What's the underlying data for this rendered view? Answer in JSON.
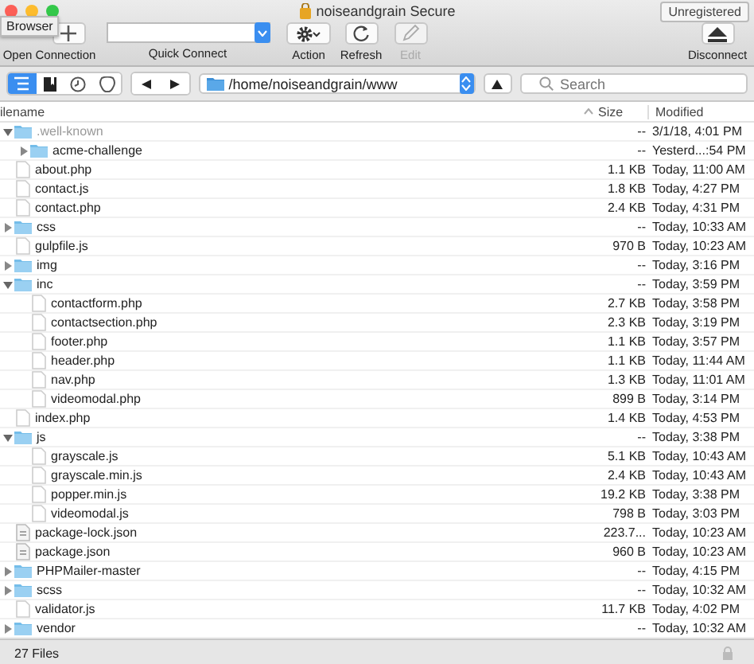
{
  "window": {
    "title": "noiseandgrain Secure",
    "badge": "Unregistered"
  },
  "tooltip": "Browser",
  "toolbar": [
    {
      "kind": "open",
      "label": "Open Connection",
      "disabled": false
    },
    {
      "kind": "combo",
      "label": "Quick Connect",
      "disabled": false
    },
    {
      "kind": "action",
      "label": "Action",
      "disabled": false
    },
    {
      "kind": "refresh",
      "label": "Refresh",
      "disabled": false
    },
    {
      "kind": "edit",
      "label": "Edit",
      "disabled": true
    },
    {
      "kind": "disconnect",
      "label": "Disconnect",
      "disabled": false
    }
  ],
  "views": [
    {
      "kind": "browser",
      "selected": true
    },
    {
      "kind": "bookmarks",
      "selected": false
    },
    {
      "kind": "history",
      "selected": false
    },
    {
      "kind": "bonjour",
      "selected": false
    }
  ],
  "path": "/home/noiseandgrain/www",
  "search": {
    "placeholder": "Search"
  },
  "columns": [
    "ilename",
    "Size",
    "Modified"
  ],
  "rows": [
    {
      "kind": "folder",
      "name": ".well-known",
      "size": "--",
      "modified": "3/1/18, 4:01 PM",
      "hidden": true,
      "expanded": true,
      "children": [
        {
          "kind": "folder",
          "name": "acme-challenge",
          "size": "--",
          "modified": "Yesterd...:54 PM",
          "hidden": false,
          "expanded": false
        }
      ]
    },
    {
      "kind": "file",
      "name": "about.php",
      "size": "1.1 KB",
      "modified": "Today, 11:00 AM",
      "hidden": false
    },
    {
      "kind": "file",
      "name": "contact.js",
      "size": "1.8 KB",
      "modified": "Today, 4:27 PM",
      "hidden": false
    },
    {
      "kind": "file",
      "name": "contact.php",
      "size": "2.4 KB",
      "modified": "Today, 4:31 PM",
      "hidden": false
    },
    {
      "kind": "folder",
      "name": "css",
      "size": "--",
      "modified": "Today, 10:33 AM",
      "hidden": false,
      "expanded": false
    },
    {
      "kind": "file",
      "name": "gulpfile.js",
      "size": "970 B",
      "modified": "Today, 10:23 AM",
      "hidden": false
    },
    {
      "kind": "folder",
      "name": "img",
      "size": "--",
      "modified": "Today, 3:16 PM",
      "hidden": false,
      "expanded": false
    },
    {
      "kind": "folder",
      "name": "inc",
      "size": "--",
      "modified": "Today, 3:59 PM",
      "hidden": false,
      "expanded": true,
      "children": [
        {
          "kind": "file",
          "name": "contactform.php",
          "size": "2.7 KB",
          "modified": "Today, 3:58 PM",
          "hidden": false
        },
        {
          "kind": "file",
          "name": "contactsection.php",
          "size": "2.3 KB",
          "modified": "Today, 3:19 PM",
          "hidden": false
        },
        {
          "kind": "file",
          "name": "footer.php",
          "size": "1.1 KB",
          "modified": "Today, 3:57 PM",
          "hidden": false
        },
        {
          "kind": "file",
          "name": "header.php",
          "size": "1.1 KB",
          "modified": "Today, 11:44 AM",
          "hidden": false
        },
        {
          "kind": "file",
          "name": "nav.php",
          "size": "1.3 KB",
          "modified": "Today, 11:01 AM",
          "hidden": false
        },
        {
          "kind": "file",
          "name": "videomodal.php",
          "size": "899 B",
          "modified": "Today, 3:14 PM",
          "hidden": false
        }
      ]
    },
    {
      "kind": "file",
      "name": "index.php",
      "size": "1.4 KB",
      "modified": "Today, 4:53 PM",
      "hidden": false
    },
    {
      "kind": "folder",
      "name": "js",
      "size": "--",
      "modified": "Today, 3:38 PM",
      "hidden": false,
      "expanded": true,
      "children": [
        {
          "kind": "file",
          "name": "grayscale.js",
          "size": "5.1 KB",
          "modified": "Today, 10:43 AM",
          "hidden": false
        },
        {
          "kind": "file",
          "name": "grayscale.min.js",
          "size": "2.4 KB",
          "modified": "Today, 10:43 AM",
          "hidden": false
        },
        {
          "kind": "file",
          "name": "popper.min.js",
          "size": "19.2 KB",
          "modified": "Today, 3:38 PM",
          "hidden": false
        },
        {
          "kind": "file",
          "name": "videomodal.js",
          "size": "798 B",
          "modified": "Today, 3:03 PM",
          "hidden": false
        }
      ]
    },
    {
      "kind": "document",
      "name": "package-lock.json",
      "size": "223.7...",
      "modified": "Today, 10:23 AM",
      "hidden": false
    },
    {
      "kind": "document",
      "name": "package.json",
      "size": "960 B",
      "modified": "Today, 10:23 AM",
      "hidden": false
    },
    {
      "kind": "folder",
      "name": "PHPMailer-master",
      "size": "--",
      "modified": "Today, 4:15 PM",
      "hidden": false,
      "expanded": false
    },
    {
      "kind": "folder",
      "name": "scss",
      "size": "--",
      "modified": "Today, 10:32 AM",
      "hidden": false,
      "expanded": false
    },
    {
      "kind": "file",
      "name": "validator.js",
      "size": "11.7 KB",
      "modified": "Today, 4:02 PM",
      "hidden": false
    },
    {
      "kind": "folder",
      "name": "vendor",
      "size": "--",
      "modified": "Today, 10:32 AM",
      "hidden": false,
      "expanded": false
    }
  ],
  "status": "27 Files"
}
